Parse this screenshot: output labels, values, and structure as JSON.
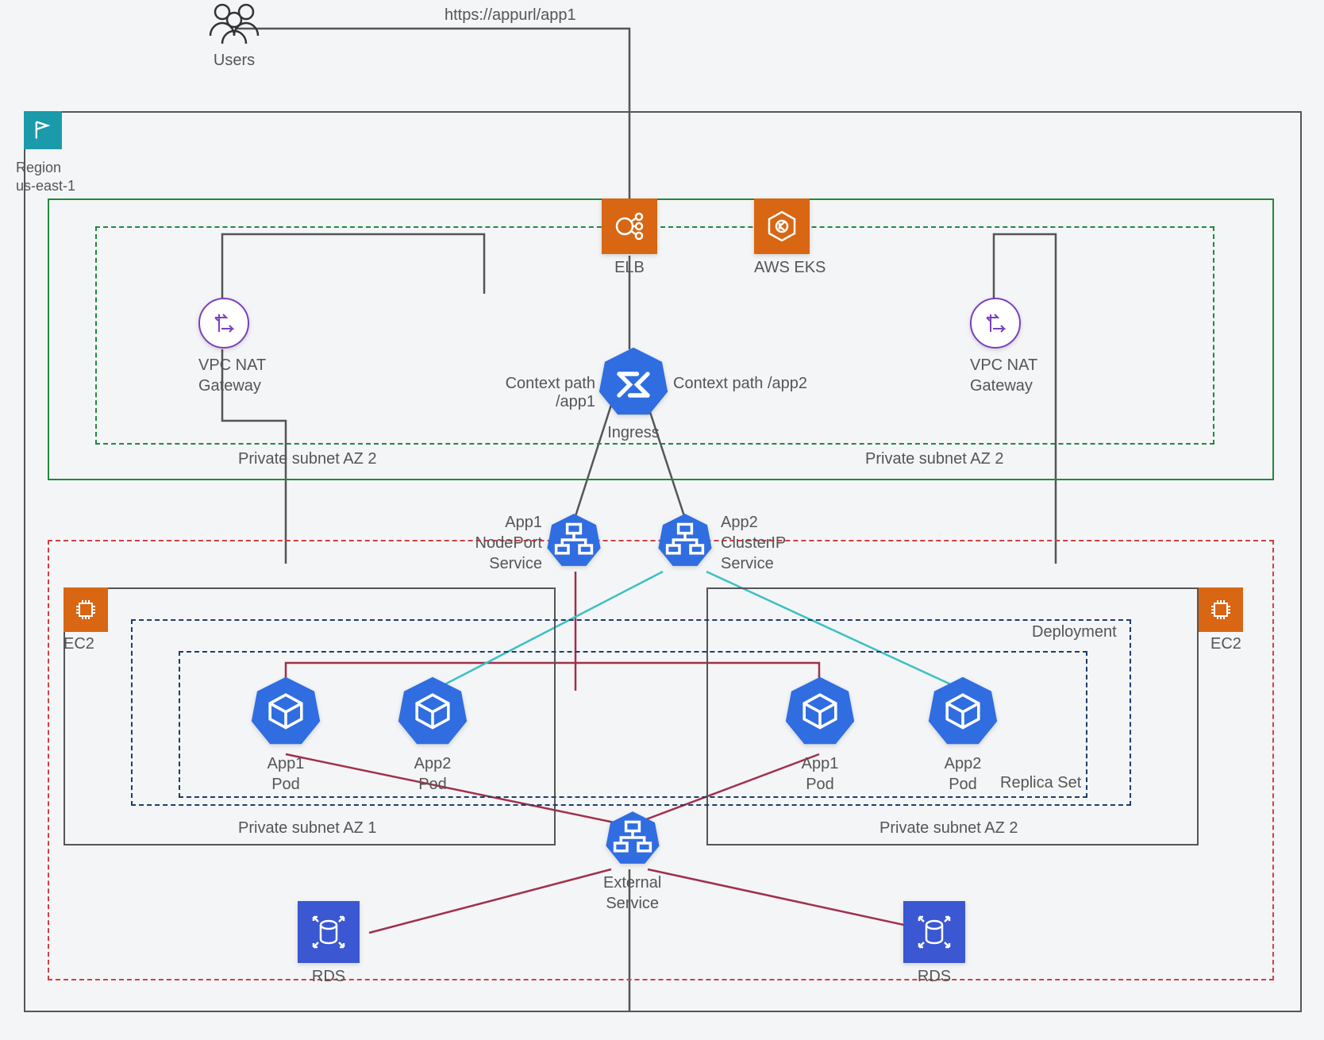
{
  "users_label": "Users",
  "url_label": "https://appurl/app1",
  "region": {
    "title": "Region",
    "name": "us-east-1"
  },
  "elb_label": "ELB",
  "eks_label": "AWS EKS",
  "nat_left": {
    "l1": "VPC NAT",
    "l2": "Gateway"
  },
  "nat_right": {
    "l1": "VPC NAT",
    "l2": "Gateway"
  },
  "ingress": {
    "left_text": "Context path /app1",
    "right_text": "Context path /app2",
    "label": "Ingress"
  },
  "pub_subnet_left": "Private subnet AZ 2",
  "pub_subnet_right": "Private subnet AZ 2",
  "svc1": {
    "l1": "App1",
    "l2": "NodePort",
    "l3": "Service"
  },
  "svc2": {
    "l1": "App2",
    "l2": "ClusterIP",
    "l3": "Service"
  },
  "ec2_left": "EC2",
  "ec2_right": "EC2",
  "deployment_label": "Deployment",
  "replicaset_label": "Replica Set",
  "pods": {
    "p1": {
      "l1": "App1",
      "l2": "Pod"
    },
    "p2": {
      "l1": "App2",
      "l2": "Pod"
    },
    "p3": {
      "l1": "App1",
      "l2": "Pod"
    },
    "p4": {
      "l1": "App2",
      "l2": "Pod"
    }
  },
  "priv_subnet_left": "Private subnet AZ 1",
  "priv_subnet_right": "Private subnet AZ 2",
  "ext_svc": {
    "l1": "External",
    "l2": "Service"
  },
  "rds_left": "RDS",
  "rds_right": "RDS",
  "colors": {
    "orange": "#d86613",
    "k8s_blue": "#2f6de1",
    "green": "#1f8b3b",
    "red": "#d23f3f",
    "navy": "#1d3d6b",
    "grey": "#555555",
    "teal": "#3cc0c3",
    "maroon": "#a0304a"
  }
}
